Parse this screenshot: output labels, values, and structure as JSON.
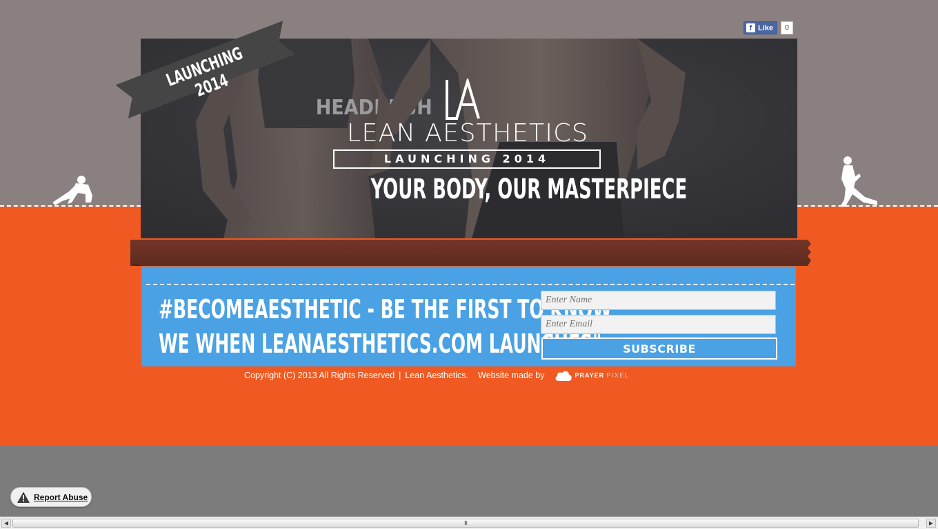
{
  "facebook": {
    "like_label": "Like",
    "like_count": "0",
    "icon": "facebook-f-icon"
  },
  "ribbon": {
    "text": "LAUNCHING 2014"
  },
  "brand": {
    "name": "LEAN AESTHETICS",
    "launching": "LAUNCHING 2014",
    "tagline": "YOUR BODY, OUR MASTERPIECE",
    "shirt_text": "HEADRUSH"
  },
  "promo": {
    "line1": "#BECOMEAESTHETIC - BE THE FIRST TO KNOW",
    "line2": "WE WHEN LEANAESTHETICS.COM LAUNCHES\""
  },
  "form": {
    "name_placeholder": "Enter Name",
    "email_placeholder": "Enter Email",
    "subscribe_label": "SUBSCRIBE"
  },
  "footer": {
    "copyright": "Copyright (C) 2013 All Rights Reserved",
    "separator": "|",
    "company": "Lean Aesthetics.",
    "made_by": "Website made by",
    "maker_a": "PRAYER",
    "maker_b": "PIXEL"
  },
  "report": {
    "label": "Report Abuse",
    "icon": "warning-icon"
  },
  "scrollbar": {
    "thumb_grip": "III",
    "left_arrow": "◀",
    "right_arrow": "▶"
  },
  "colors": {
    "orange": "#f05a22",
    "panel_blue": "#4aa1e3",
    "banner_brown": "#6b3124",
    "top_gray": "#8a8080"
  }
}
